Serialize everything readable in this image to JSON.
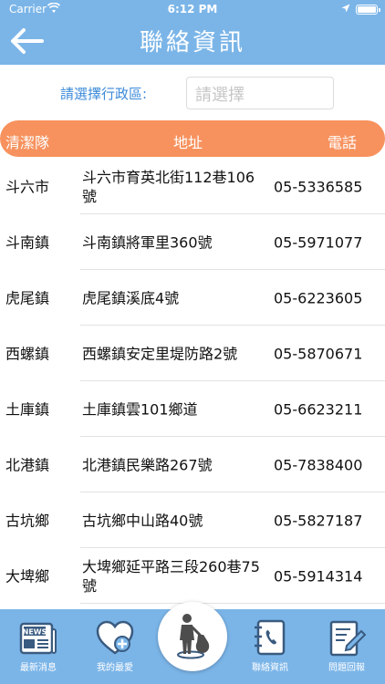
{
  "status_bar": {
    "carrier": "Carrier",
    "time": "6:12 PM"
  },
  "header": {
    "title": "聯絡資訊"
  },
  "filter": {
    "label": "請選擇行政區:",
    "placeholder": "請選擇"
  },
  "table": {
    "headers": {
      "team": "清潔隊",
      "address": "地址",
      "phone": "電話"
    },
    "rows": [
      {
        "team": "斗六市",
        "address": "斗六市育英北街112巷106號",
        "phone": "05-5336585"
      },
      {
        "team": "斗南鎮",
        "address": "斗南鎮將軍里360號",
        "phone": "05-5971077"
      },
      {
        "team": "虎尾鎮",
        "address": "虎尾鎮溪底4號",
        "phone": "05-6223605"
      },
      {
        "team": "西螺鎮",
        "address": "西螺鎮安定里堤防路2號",
        "phone": "05-5870671"
      },
      {
        "team": "土庫鎮",
        "address": "土庫鎮雲101鄉道",
        "phone": "05-6623211"
      },
      {
        "team": "北港鎮",
        "address": "北港鎮民樂路267號",
        "phone": "05-7838400"
      },
      {
        "team": "古坑鄉",
        "address": "古坑鄉中山路40號",
        "phone": "05-5827187"
      },
      {
        "team": "大埤鄉",
        "address": "大埤鄉延平路三段260巷75號",
        "phone": "05-5914314"
      }
    ]
  },
  "tabbar": {
    "news": "最新消息",
    "favorites": "我的最愛",
    "contact": "聯絡資訊",
    "feedback": "問題回報",
    "news_icon_text": "NEWS"
  },
  "colors": {
    "header_bg": "#7bb5e8",
    "table_header_bg": "#f7925e",
    "label_blue": "#3b8ad9"
  },
  "icons": {
    "back": "arrow-left-icon",
    "news": "newspaper-icon",
    "favorites": "heart-plus-icon",
    "center": "person-trash-bag-icon",
    "contact": "phone-book-icon",
    "feedback": "form-edit-icon"
  }
}
